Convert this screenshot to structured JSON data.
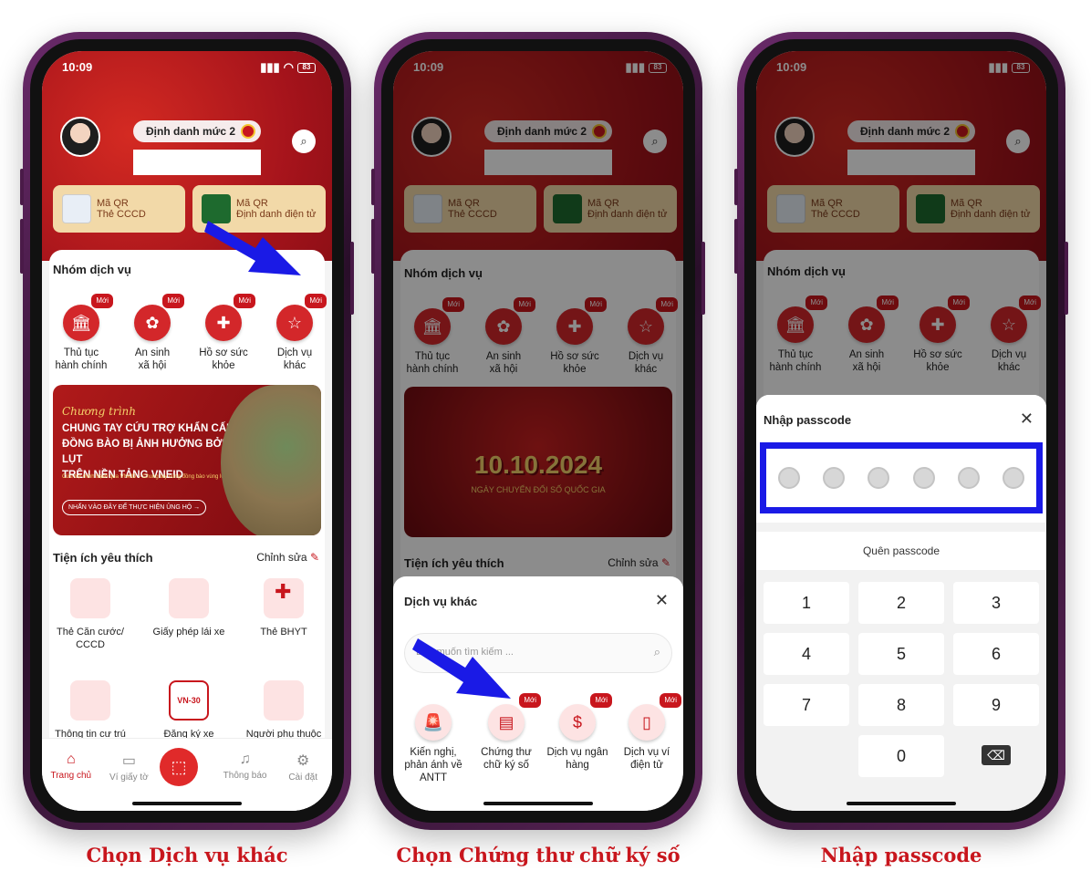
{
  "status_time": "10:09",
  "battery": "83",
  "level_label": "Định danh mức 2",
  "qr1": [
    "Mã QR",
    "Thẻ CCCD"
  ],
  "qr2": [
    "Mã QR",
    "Định danh điện tử"
  ],
  "services_title": "Nhóm dịch vụ",
  "new_badge": "Mới",
  "services": [
    [
      "Thủ tục",
      "hành chính"
    ],
    [
      "An sinh",
      "xã hội"
    ],
    [
      "Hồ sơ sức",
      "khỏe"
    ],
    [
      "Dịch vụ",
      "khác"
    ]
  ],
  "banner1": {
    "script": "Chương trình",
    "l1": "CHUNG TAY CỨU TRỢ KHẨN CẤP",
    "l2": "ĐỒNG BÀO BỊ ẢNH HƯỞNG BỞI LŨ LỤT",
    "l3": "TRÊN NỀN TẢNG VNEID",
    "small": "Cứu trợ minh bạch qua VNeID – Chung tay cùng đồng bào vùng lũ",
    "cta": "NHẤN VÀO ĐÂY ĐỂ THỰC HIỆN ỦNG HỘ →"
  },
  "banner2": {
    "date": "10.10.2024",
    "sub": "NGÀY CHUYỂN ĐỔI SỐ QUỐC GIA"
  },
  "fav_title": "Tiện ích yêu thích",
  "edit_label": "Chỉnh sửa",
  "favs": [
    [
      "Thẻ Căn cước/",
      "CCCD"
    ],
    [
      "Giấy phép lái xe",
      ""
    ],
    [
      "Thẻ BHYT",
      ""
    ],
    [
      "Thông tin cư trú",
      ""
    ],
    [
      "Đăng ký xe",
      ""
    ],
    [
      "Người phụ thuộc",
      ""
    ]
  ],
  "vn30": "VN-30",
  "tabs": [
    "Trang chủ",
    "Ví giấy tờ",
    "",
    "Thông báo",
    "Cài đặt"
  ],
  "sheet2": {
    "title": "Dịch vụ khác",
    "search_placeholder": "Bạn muốn tìm kiếm ...",
    "items": [
      [
        "Kiến nghị,",
        "phản ánh về",
        "ANTT"
      ],
      [
        "Chứng thư",
        "chữ ký số",
        ""
      ],
      [
        "Dịch vụ ngân",
        "hàng",
        ""
      ],
      [
        "Dịch vụ ví",
        "điện tử",
        ""
      ]
    ]
  },
  "sheet3": {
    "title": "Nhập passcode",
    "forgot": "Quên passcode",
    "keys": [
      "1",
      "2",
      "3",
      "4",
      "5",
      "6",
      "7",
      "8",
      "9",
      "",
      "0",
      "⌫"
    ]
  },
  "captions": [
    "Chọn Dịch vụ khác",
    "Chọn Chứng thư chữ ký số",
    "Nhập passcode"
  ],
  "colors": {
    "brand_red": "#c8161d",
    "arrow_blue": "#1a1ae6",
    "header_red": "#b0181c"
  }
}
